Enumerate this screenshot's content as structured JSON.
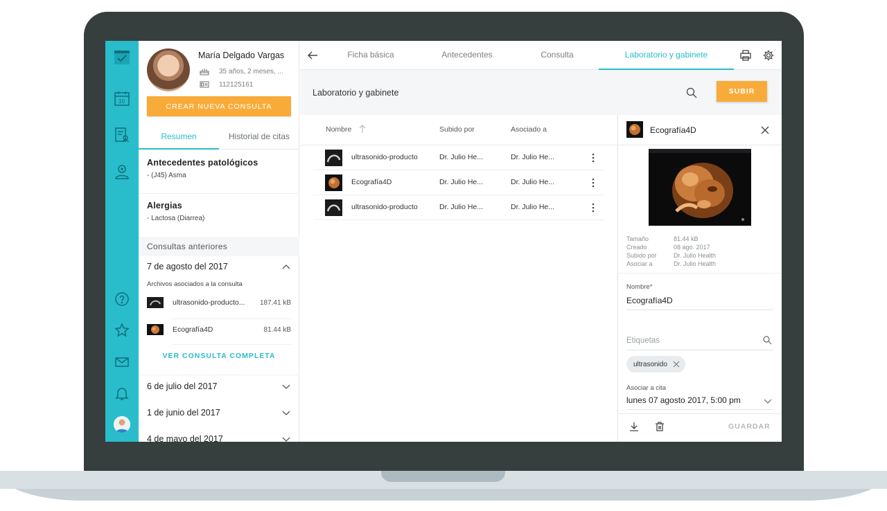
{
  "patient": {
    "name": "María Delgado Vargas",
    "age": "35 años, 2 meses, ...",
    "id_number": "112125161",
    "new_consult_label": "CREAR NUEVA CONSULTA",
    "tabs": [
      {
        "label": "Resumen",
        "active": true
      },
      {
        "label": "Historial de citas",
        "active": false
      }
    ],
    "pathological": {
      "title": "Antecedentes patológicos",
      "item": "- (J45) Asma"
    },
    "allergies": {
      "title": "Alergias",
      "item": "- Lactosa (Diarrea)"
    },
    "previous_title": "Consultas anteriores",
    "consults": [
      {
        "date": "7 de agosto del 2017",
        "expanded": true
      },
      {
        "date": "6 de julio del 2017",
        "expanded": false
      },
      {
        "date": "1 de junio del 2017",
        "expanded": false
      },
      {
        "date": "4 de mayo del 2017",
        "expanded": false
      }
    ],
    "files_label": "Archivos asociados a la consulta",
    "files": [
      {
        "name": "ultrasonido-producto...",
        "size": "187.41 kB"
      },
      {
        "name": "Ecografía4D",
        "size": "81.44 kB"
      }
    ],
    "view_full_label": "VER CONSULTA COMPLETA"
  },
  "nav": {
    "tabs": [
      {
        "label": "Ficha básica",
        "active": false
      },
      {
        "label": "Antecedentes",
        "active": false
      },
      {
        "label": "Consulta",
        "active": false
      },
      {
        "label": "Laboratorio y gabinete",
        "active": true
      }
    ]
  },
  "lab": {
    "title": "Laboratorio y gabinete",
    "upload_label": "SUBIR",
    "columns": {
      "name": "Nombre",
      "uploaded_by": "Subido por",
      "associated": "Asociado a"
    },
    "rows": [
      {
        "name": "ultrasonido-producto",
        "uploaded_by": "Dr. Julio He...",
        "associated": "Dr. Julio He..."
      },
      {
        "name": "Ecografía4D",
        "uploaded_by": "Dr. Julio He...",
        "associated": "Dr. Julio He..."
      },
      {
        "name": "ultrasonido-producto",
        "uploaded_by": "Dr. Julio He...",
        "associated": "Dr. Julio He..."
      }
    ]
  },
  "detail": {
    "title": "Ecografía4D",
    "meta": [
      {
        "key": "Tamaño",
        "value": "81.44 kB"
      },
      {
        "key": "Creado",
        "value": "08 ago. 2017"
      },
      {
        "key": "Subido por",
        "value": "Dr. Julio Health"
      },
      {
        "key": "Asociar a",
        "value": "Dr. Julio Health"
      }
    ],
    "name_label": "Nombre*",
    "name_value": "Ecografía4D",
    "tags_placeholder": "Etiquetas",
    "tag": "ultrasonido",
    "assoc_label": "Asociar a cita",
    "assoc_value": "lunes 07 agosto 2017, 5:00 pm",
    "save_label": "GUARDAR"
  },
  "colors": {
    "accent": "#29bccb",
    "orange": "#f9ab3a",
    "frame": "#363f3e"
  }
}
